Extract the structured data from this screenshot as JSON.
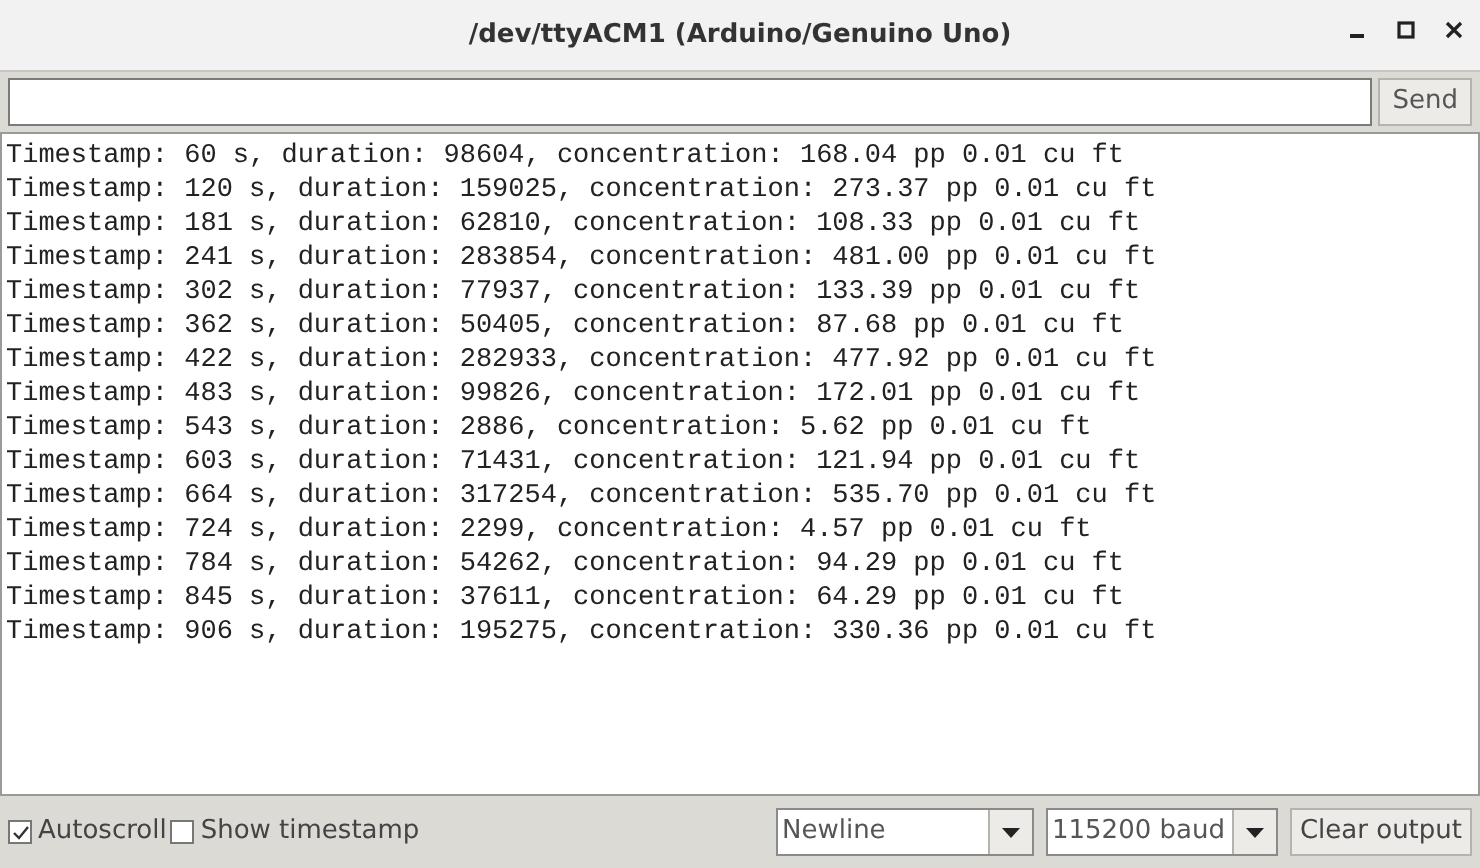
{
  "window": {
    "title": "/dev/ttyACM1 (Arduino/Genuino Uno)"
  },
  "send_button": "Send",
  "output_lines": [
    "Timestamp: 60 s, duration: 98604, concentration: 168.04 pp 0.01 cu ft",
    "Timestamp: 120 s, duration: 159025, concentration: 273.37 pp 0.01 cu ft",
    "Timestamp: 181 s, duration: 62810, concentration: 108.33 pp 0.01 cu ft",
    "Timestamp: 241 s, duration: 283854, concentration: 481.00 pp 0.01 cu ft",
    "Timestamp: 302 s, duration: 77937, concentration: 133.39 pp 0.01 cu ft",
    "Timestamp: 362 s, duration: 50405, concentration: 87.68 pp 0.01 cu ft",
    "Timestamp: 422 s, duration: 282933, concentration: 477.92 pp 0.01 cu ft",
    "Timestamp: 483 s, duration: 99826, concentration: 172.01 pp 0.01 cu ft",
    "Timestamp: 543 s, duration: 2886, concentration: 5.62 pp 0.01 cu ft",
    "Timestamp: 603 s, duration: 71431, concentration: 121.94 pp 0.01 cu ft",
    "Timestamp: 664 s, duration: 317254, concentration: 535.70 pp 0.01 cu ft",
    "Timestamp: 724 s, duration: 2299, concentration: 4.57 pp 0.01 cu ft",
    "Timestamp: 784 s, duration: 54262, concentration: 94.29 pp 0.01 cu ft",
    "Timestamp: 845 s, duration: 37611, concentration: 64.29 pp 0.01 cu ft",
    "Timestamp: 906 s, duration: 195275, concentration: 330.36 pp 0.01 cu ft"
  ],
  "options": [
    {
      "label": "Autoscroll",
      "checked": true
    },
    {
      "label": "Show timestamp",
      "checked": false
    }
  ],
  "line_ending": {
    "value": "Newline"
  },
  "baud_rate": {
    "value": "115200 baud"
  },
  "clear_button": "Clear output"
}
